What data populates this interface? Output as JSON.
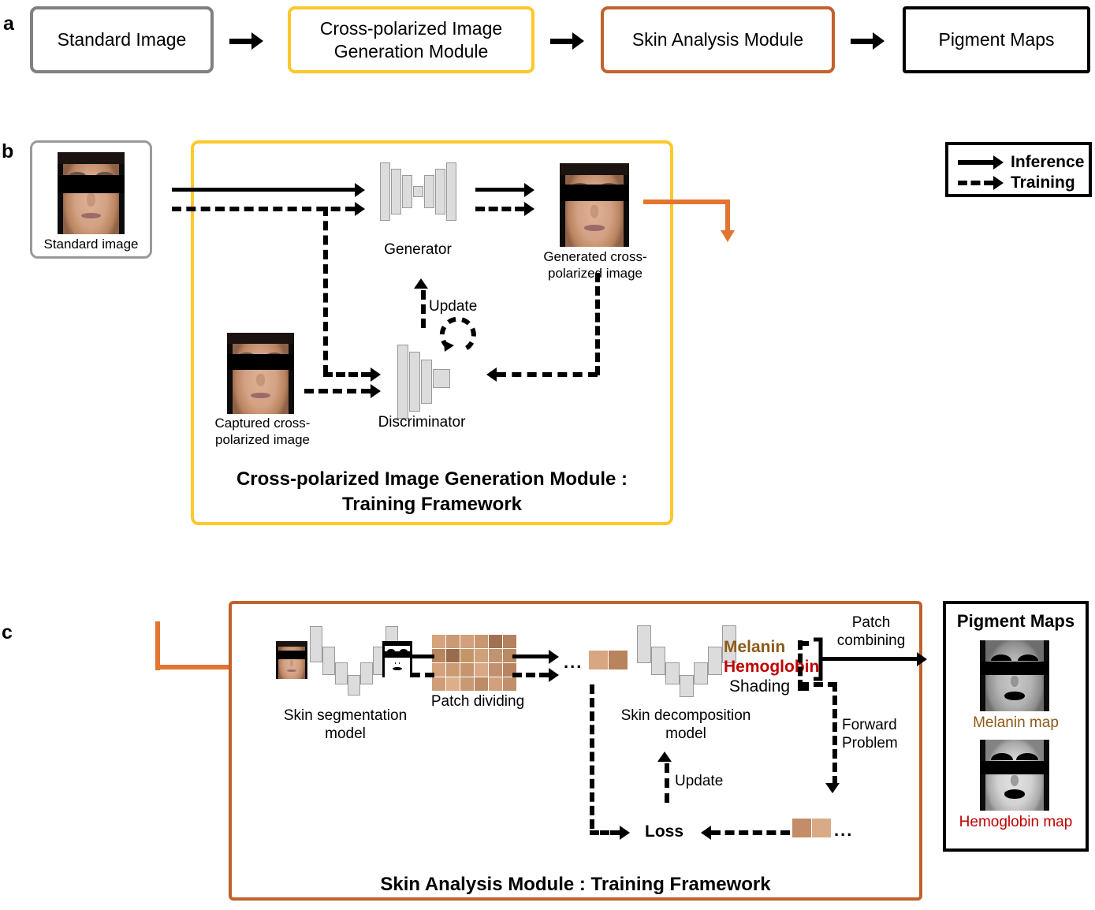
{
  "figure": {
    "panels": [
      "a",
      "b",
      "c"
    ]
  },
  "panel_a": {
    "letter": "a",
    "boxes": [
      {
        "label": "Standard Image",
        "color": "#808080"
      },
      {
        "label": "Cross-polarized Image\nGeneration Module",
        "color": "#FFC72C"
      },
      {
        "label": "Skin Analysis Module",
        "color": "#C1622C"
      },
      {
        "label": "Pigment Maps",
        "color": "#000000"
      }
    ],
    "box1_line1": "Standard Image",
    "box2_line1": "Cross-polarized Image",
    "box2_line2": "Generation Module",
    "box3_line1": "Skin Analysis Module",
    "box4_line1": "Pigment Maps"
  },
  "panel_b": {
    "letter": "b",
    "module_border_color": "#FFC72C",
    "standard_image_caption": "Standard image",
    "generator_label": "Generator",
    "generated_caption_line1": "Generated cross-",
    "generated_caption_line2": "polarized image",
    "captured_caption_line1": "Captured cross-",
    "captured_caption_line2": "polarized image",
    "discriminator_label": "Discriminator",
    "update_label": "Update",
    "module_title_line1": "Cross-polarized Image Generation Module :",
    "module_title_line2": "Training Framework"
  },
  "legend": {
    "items": [
      {
        "label": "Inference",
        "style": "solid-arrow"
      },
      {
        "label": "Training",
        "style": "dashed-arrow"
      }
    ],
    "inference_label": "Inference",
    "training_label": "Training"
  },
  "panel_c": {
    "letter": "c",
    "module_border_color": "#C1622C",
    "skin_segmentation_line1": "Skin segmentation",
    "skin_segmentation_line2": "model",
    "patch_dividing_label": "Patch dividing",
    "skin_decomposition_line1": "Skin decomposition",
    "skin_decomposition_line2": "model",
    "component_melanin": "Melanin",
    "component_hemoglobin": "Hemoglobin",
    "component_shading": "Shading",
    "melanin_color": "#8C5A17",
    "hemoglobin_color": "#C00000",
    "shading_color": "#000000",
    "patch_combining_line1": "Patch",
    "patch_combining_line2": "combining",
    "forward_problem_line1": "Forward",
    "forward_problem_line2": "Problem",
    "update_label": "Update",
    "loss_label": "Loss",
    "ellipsis": "...",
    "module_title": "Skin Analysis Module : Training Framework"
  },
  "pigment_maps": {
    "title": "Pigment Maps",
    "melanin_caption": "Melanin map",
    "hemoglobin_caption": "Hemoglobin map",
    "melanin_color": "#8C5A17",
    "hemoglobin_color": "#C00000",
    "border_color": "#000000"
  }
}
